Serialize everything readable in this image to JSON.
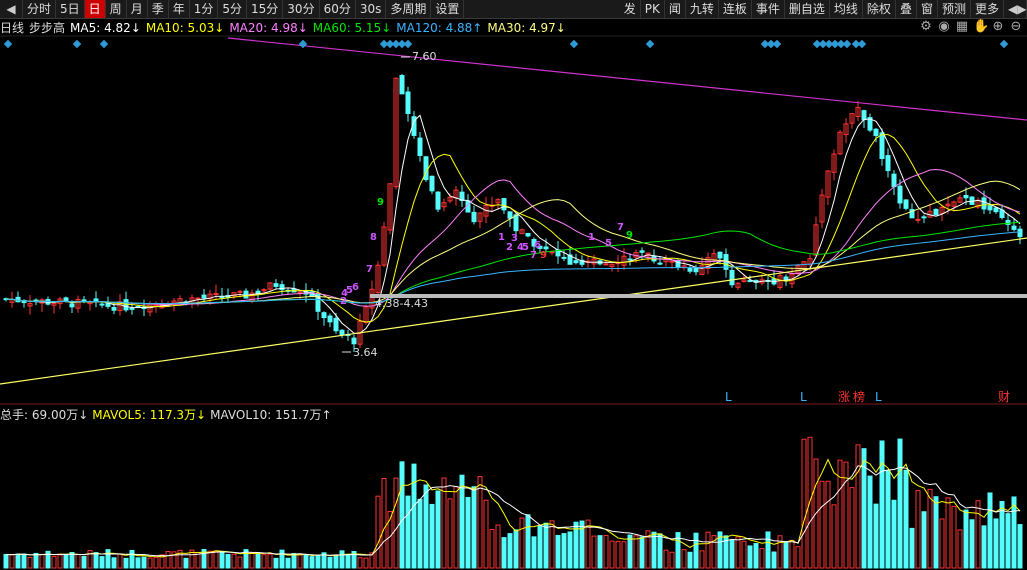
{
  "toolbar": {
    "left_items": [
      "分时",
      "5日",
      "日",
      "周",
      "月",
      "季",
      "年",
      "1分",
      "5分",
      "15分",
      "30分",
      "60分",
      "30s",
      "多周期",
      "设置"
    ],
    "active": "日",
    "right_items": [
      "发",
      "PK",
      "闻",
      "九转",
      "连板",
      "事件",
      "删自选",
      "均线",
      "除权",
      "叠",
      "窗",
      "预测",
      "更多"
    ]
  },
  "info": {
    "period": "日线",
    "indicator": "步步高",
    "ma5": "MA5: 4.82↓",
    "ma10": "MA10: 5.03↓",
    "ma20": "MA20: 4.98↓",
    "ma60": "MA60: 5.15↓",
    "ma120": "MA120: 4.88↑",
    "ma30": "MA30: 4.97↓"
  },
  "price_labels": {
    "high": "7.60",
    "low": "3.64",
    "range": "4.38-4.43"
  },
  "markers": [
    "L",
    "L",
    "涨",
    "榜",
    "L",
    "财"
  ],
  "sequence_numbers": [
    "9",
    "8",
    "7",
    "6",
    "5",
    "4",
    "3",
    "2",
    "1",
    "9",
    "8",
    "7",
    "6",
    "5",
    "4",
    "3",
    "2",
    "1",
    "9"
  ],
  "volume": {
    "total": "总手: 69.00万↓",
    "mavol5": "MAVOL5: 117.3万↓",
    "mavol10": "MAVOL10: 151.7万↑"
  },
  "colors": {
    "up": "#ff3232",
    "down": "#54fcfc",
    "ma5": "#ffffff",
    "ma10": "#ffff00",
    "ma20": "#ff80ff",
    "ma60": "#00e600",
    "ma120": "#3ab4ff",
    "ma30": "#ffff80",
    "trendline": "#cc33cc",
    "support": "#ffff66",
    "diamond": "#2e9bd6"
  },
  "icons": [
    "settings-icon",
    "eye-icon",
    "grid-icon",
    "hand-icon",
    "add-icon",
    "remove-icon"
  ]
}
